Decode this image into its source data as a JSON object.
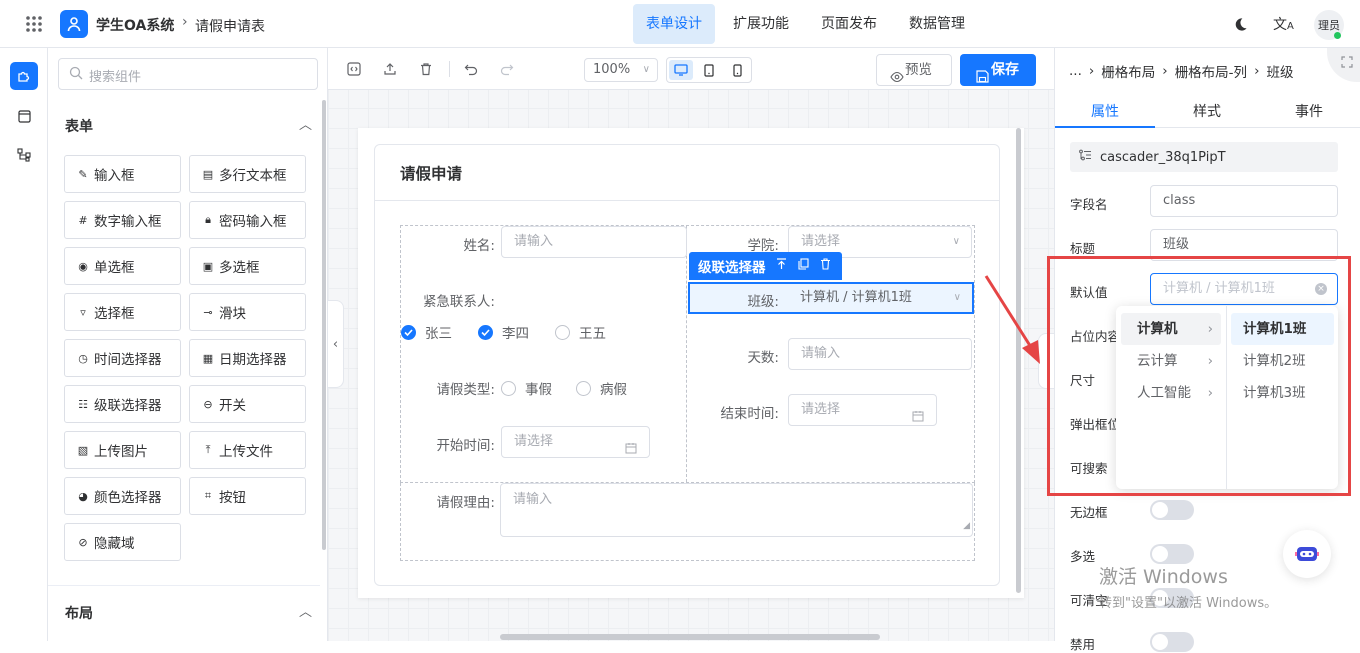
{
  "header": {
    "app_name": "学生OA系统",
    "breadcrumb_page": "请假申请表",
    "tabs": [
      {
        "label": "表单设计",
        "active": true
      },
      {
        "label": "扩展功能",
        "active": false
      },
      {
        "label": "页面发布",
        "active": false
      },
      {
        "label": "数据管理",
        "active": false
      }
    ],
    "avatar_text": "理员",
    "accent_color": "#1677ff"
  },
  "left_panel": {
    "search_placeholder": "搜索组件",
    "section_form": "表单",
    "components": [
      {
        "label": "输入框",
        "icon": "edit-icon"
      },
      {
        "label": "多行文本框",
        "icon": "textarea-icon"
      },
      {
        "label": "数字输入框",
        "icon": "number-icon"
      },
      {
        "label": "密码输入框",
        "icon": "lock-icon"
      },
      {
        "label": "单选框",
        "icon": "radio-icon"
      },
      {
        "label": "多选框",
        "icon": "checkbox-icon"
      },
      {
        "label": "选择框",
        "icon": "select-icon"
      },
      {
        "label": "滑块",
        "icon": "slider-icon"
      },
      {
        "label": "时间选择器",
        "icon": "clock-icon"
      },
      {
        "label": "日期选择器",
        "icon": "calendar-icon"
      },
      {
        "label": "级联选择器",
        "icon": "cascader-icon"
      },
      {
        "label": "开关",
        "icon": "switch-icon"
      },
      {
        "label": "上传图片",
        "icon": "image-icon"
      },
      {
        "label": "上传文件",
        "icon": "upload-icon"
      },
      {
        "label": "颜色选择器",
        "icon": "palette-icon"
      },
      {
        "label": "按钮",
        "icon": "button-icon"
      },
      {
        "label": "隐藏域",
        "icon": "eye-off-icon"
      }
    ],
    "section_layout": "布局"
  },
  "toolbar": {
    "zoom": "100%",
    "preview_label": "预览",
    "save_label": "保存"
  },
  "form": {
    "title": "请假申请",
    "name_label": "姓名:",
    "name_placeholder": "请输入",
    "college_label": "学院:",
    "college_placeholder": "请选择",
    "selected_component_tag": "级联选择器",
    "class_label": "班级:",
    "class_value": "计算机 / 计算机1班",
    "emergency_label": "紧急联系人:",
    "emergency_options": [
      {
        "label": "张三",
        "checked": true
      },
      {
        "label": "李四",
        "checked": true
      },
      {
        "label": "王五",
        "checked": false
      }
    ],
    "days_label": "天数:",
    "days_placeholder": "请输入",
    "leave_type_label": "请假类型:",
    "leave_type_options": [
      "事假",
      "病假"
    ],
    "end_time_label": "结束时间:",
    "end_time_placeholder": "请选择",
    "start_time_label": "开始时间:",
    "start_time_placeholder": "请选择",
    "reason_label": "请假理由:",
    "reason_placeholder": "请输入"
  },
  "right_panel": {
    "breadcrumb": [
      "...",
      "栅格布局",
      "栅格布局-列",
      "班级"
    ],
    "tabs": [
      {
        "label": "属性",
        "active": true
      },
      {
        "label": "样式",
        "active": false
      },
      {
        "label": "事件",
        "active": false
      }
    ],
    "component_id": "cascader_38q1PipT",
    "field_name_label": "字段名",
    "field_name_value": "class",
    "title_label": "标题",
    "title_value": "班级",
    "default_label": "默认值",
    "default_placeholder": "计算机 / 计算机1班",
    "placeholder_label": "占位内容",
    "size_label": "尺寸",
    "popup_position_label": "弹出框位",
    "searchable_label": "可搜索",
    "borderless_label": "无边框",
    "multiple_label": "多选",
    "clearable_label": "可清空",
    "disabled_label": "禁用",
    "cascader_level1": [
      {
        "label": "计算机",
        "active": true
      },
      {
        "label": "云计算",
        "active": false
      },
      {
        "label": "人工智能",
        "active": false
      }
    ],
    "cascader_level2": [
      {
        "label": "计算机1班",
        "active": true
      },
      {
        "label": "计算机2班",
        "active": false
      },
      {
        "label": "计算机3班",
        "active": false
      }
    ],
    "highlight_color": "#e54545"
  },
  "watermark": {
    "line1": "激活 Windows",
    "line2": "转到\"设置\"以激活 Windows。"
  }
}
